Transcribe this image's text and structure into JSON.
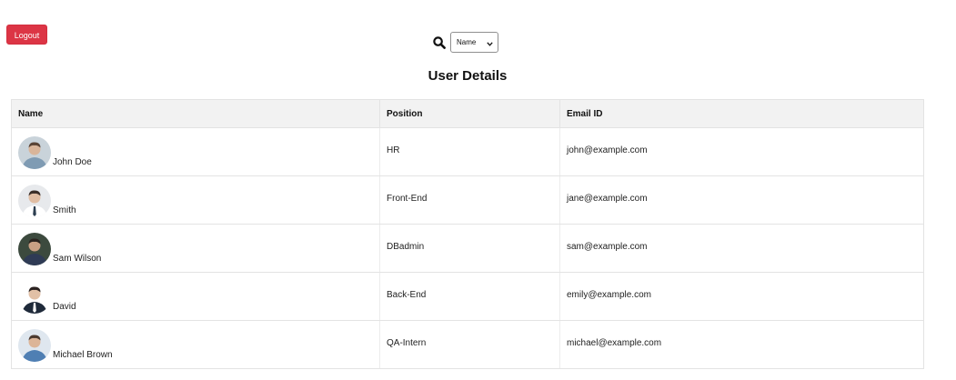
{
  "header": {
    "logout_label": "Logout",
    "search_icon": "search-icon",
    "filter_selected": "Name",
    "title": "User Details"
  },
  "colors": {
    "logout_bg": "#dc3545",
    "header_bg": "#f2f2f2",
    "border": "#e3e3e3"
  },
  "table": {
    "columns": [
      "Name",
      "Position",
      "Email ID"
    ],
    "rows": [
      {
        "name": "John Doe",
        "position": "HR",
        "email": "john@example.com",
        "avatar": "avatar-photo"
      },
      {
        "name": "Smith",
        "position": "Front-End",
        "email": "jane@example.com",
        "avatar": "avatar-photo"
      },
      {
        "name": "Sam Wilson",
        "position": "DBadmin",
        "email": "sam@example.com",
        "avatar": "avatar-photo"
      },
      {
        "name": "David",
        "position": "Back-End",
        "email": "emily@example.com",
        "avatar": "avatar-photo"
      },
      {
        "name": "Michael Brown",
        "position": "QA-Intern",
        "email": "michael@example.com",
        "avatar": "avatar-photo"
      }
    ]
  }
}
